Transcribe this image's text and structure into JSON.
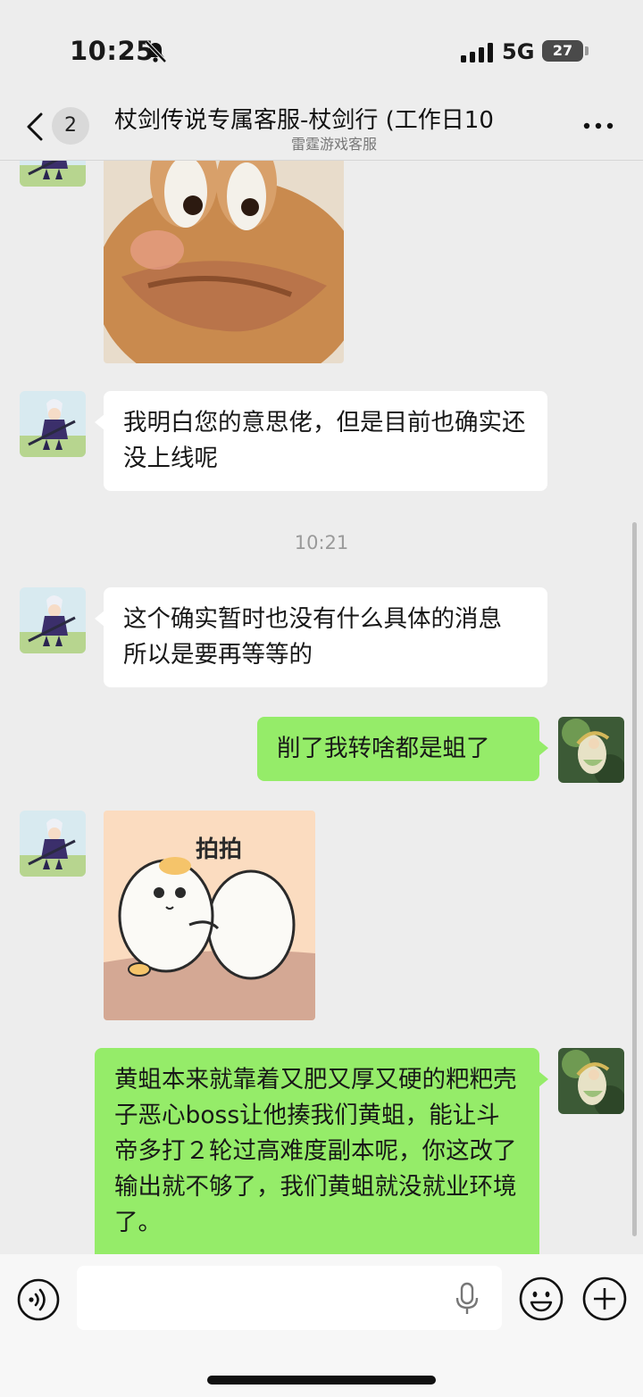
{
  "status_bar": {
    "time": "10:25",
    "network": "5G",
    "battery": "27"
  },
  "nav": {
    "unread_count": "2",
    "title": "杖剑传说专属客服-杖剑行 (工作日10",
    "subtitle": "雷霆游戏客服"
  },
  "messages": [
    {
      "sender": "agent",
      "type": "sticker",
      "sticker": "frog-sticker"
    },
    {
      "sender": "agent",
      "type": "text",
      "text": "我明白您的意思佬，但是目前也确实还没上线呢"
    },
    {
      "type": "timestamp",
      "text": "10:21"
    },
    {
      "sender": "agent",
      "type": "text",
      "text": "这个确实暂时也没有什么具体的消息 所以是要再等等的"
    },
    {
      "sender": "me",
      "type": "text",
      "text": "削了我转啥都是蛆了"
    },
    {
      "sender": "agent",
      "type": "sticker",
      "sticker": "pat-pat-sticker",
      "caption": "拍拍"
    },
    {
      "sender": "me",
      "type": "text",
      "text": "黄蛆本来就靠着又肥又厚又硬的粑粑壳子恶心boss让他揍我们黄蛆，能让斗帝多打２轮过高难度副本呢，你这改了输出就不够了，我们黄蛆就没就业环境了。"
    }
  ],
  "input": {
    "value": "",
    "placeholder": ""
  },
  "colors": {
    "background": "#ededed",
    "my_bubble": "#95ec69",
    "agent_bubble": "#ffffff"
  }
}
